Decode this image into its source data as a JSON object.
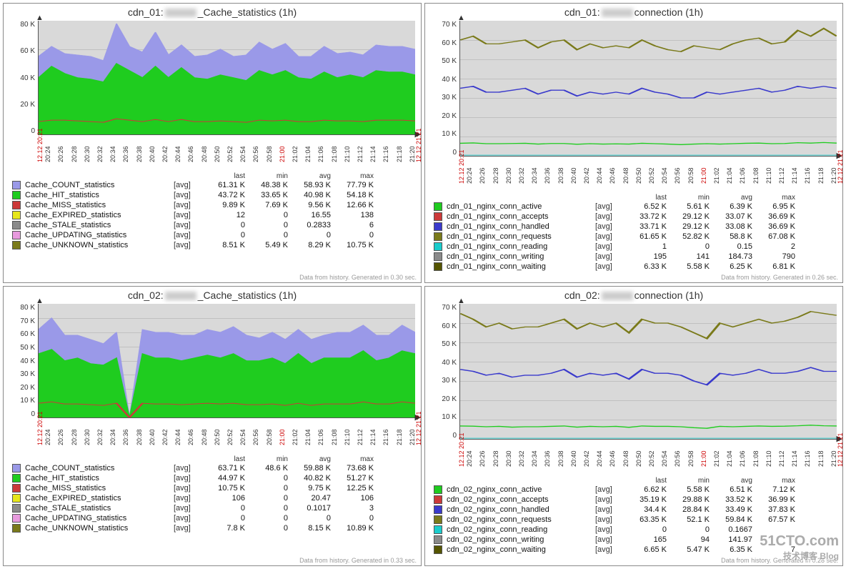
{
  "watermark": {
    "main": "51CTO.com",
    "sub": "技术博客   Blog"
  },
  "x_ticks": [
    "20:24",
    "20:26",
    "20:28",
    "20:30",
    "20:32",
    "20:34",
    "20:36",
    "20:38",
    "20:40",
    "20:42",
    "20:44",
    "20:46",
    "20:48",
    "20:50",
    "20:52",
    "20:54",
    "20:56",
    "20:58",
    "21:00",
    "21:02",
    "21:04",
    "21:06",
    "21:08",
    "21:10",
    "21:12",
    "21:14",
    "21:16",
    "21:18",
    "21:20"
  ],
  "x_start": "12.12 20:21",
  "x_end": "12.12 21:21",
  "panels": [
    {
      "id": "cache1",
      "title_pre": "cdn_01:",
      "title_post": "_Cache_statistics (1h)",
      "ymax": 80,
      "yticks": [
        "80 K",
        "60 K",
        "40 K",
        "20 K",
        "0"
      ],
      "footer": "Data from history. Generated in 0.30 sec.",
      "legend_head": [
        "last",
        "min",
        "avg",
        "max"
      ],
      "series": [
        {
          "name": "Cache_COUNT_statistics",
          "color": "#9a99e8",
          "agg": "[avg]",
          "last": "61.31 K",
          "min": "48.38 K",
          "avg": "58.93 K",
          "max": "77.79 K"
        },
        {
          "name": "Cache_HIT_statistics",
          "color": "#1fcc1f",
          "agg": "[avg]",
          "last": "43.72 K",
          "min": "33.65 K",
          "avg": "40.98 K",
          "max": "54.18 K"
        },
        {
          "name": "Cache_MISS_statistics",
          "color": "#cc3939",
          "agg": "[avg]",
          "last": "9.89 K",
          "min": "7.69 K",
          "avg": "9.56 K",
          "max": "12.66 K"
        },
        {
          "name": "Cache_EXPIRED_statistics",
          "color": "#e6e61a",
          "agg": "[avg]",
          "last": "12",
          "min": "0",
          "avg": "16.55",
          "max": "138"
        },
        {
          "name": "Cache_STALE_statistics",
          "color": "#8a8a8a",
          "agg": "[avg]",
          "last": "0",
          "min": "0",
          "avg": "0.2833",
          "max": "6"
        },
        {
          "name": "Cache_UPDATING_statistics",
          "color": "#e89ade",
          "agg": "[avg]",
          "last": "0",
          "min": "0",
          "avg": "0",
          "max": "0"
        },
        {
          "name": "Cache_UNKNOWN_statistics",
          "color": "#7a7a1a",
          "agg": "[avg]",
          "last": "8.51 K",
          "min": "5.49 K",
          "avg": "8.29 K",
          "max": "10.75 K"
        }
      ],
      "chart_data": {
        "type": "area",
        "x": [
          "20:24",
          "20:26",
          "20:28",
          "20:30",
          "20:32",
          "20:34",
          "20:36",
          "20:38",
          "20:40",
          "20:42",
          "20:44",
          "20:46",
          "20:48",
          "20:50",
          "20:52",
          "20:54",
          "20:56",
          "20:58",
          "21:00",
          "21:02",
          "21:04",
          "21:06",
          "21:08",
          "21:10",
          "21:12",
          "21:14",
          "21:16",
          "21:18",
          "21:20"
        ],
        "series": [
          {
            "name": "COUNT",
            "values": [
              55,
              62,
              57,
              56,
              55,
              52,
              78,
              62,
              58,
              72,
              56,
              63,
              55,
              56,
              60,
              55,
              56,
              65,
              60,
              64,
              55,
              55,
              62,
              57,
              58,
              56,
              63,
              62,
              62,
              60
            ]
          },
          {
            "name": "HIT",
            "values": [
              40,
              48,
              43,
              40,
              39,
              37,
              50,
              45,
              40,
              48,
              40,
              47,
              40,
              39,
              42,
              40,
              38,
              45,
              42,
              45,
              40,
              39,
              44,
              40,
              42,
              40,
              45,
              44,
              44,
              42
            ]
          },
          {
            "name": "MISS",
            "values": [
              9,
              10,
              10,
              9.5,
              9,
              8.5,
              11,
              10,
              9,
              10.5,
              9,
              10.5,
              9,
              9,
              9.5,
              9,
              8.5,
              10,
              9.5,
              10,
              9,
              9,
              10,
              9.5,
              9.5,
              9,
              10,
              10,
              10,
              9.5
            ]
          }
        ],
        "ylim": [
          0,
          80000
        ],
        "ylabel": "",
        "title": "cdn_01 Cache_statistics (1h)"
      }
    },
    {
      "id": "conn1",
      "title_pre": "cdn_01:",
      "title_post": "connection (1h)",
      "ymax": 70,
      "yticks": [
        "70 K",
        "60 K",
        "50 K",
        "40 K",
        "30 K",
        "20 K",
        "10 K",
        "0"
      ],
      "footer": "Data from history. Generated in 0.26 sec.",
      "legend_head": [
        "last",
        "min",
        "avg",
        "max"
      ],
      "series": [
        {
          "name": "cdn_01_nginx_conn_active",
          "color": "#1fcc1f",
          "agg": "[avg]",
          "last": "6.52 K",
          "min": "5.61 K",
          "avg": "6.39 K",
          "max": "6.95 K"
        },
        {
          "name": "cdn_01_nginx_conn_accepts",
          "color": "#cc3939",
          "agg": "[avg]",
          "last": "33.72 K",
          "min": "29.12 K",
          "avg": "33.07 K",
          "max": "36.69 K"
        },
        {
          "name": "cdn_01_nginx_conn_handled",
          "color": "#3a3acc",
          "agg": "[avg]",
          "last": "33.71 K",
          "min": "29.12 K",
          "avg": "33.08 K",
          "max": "36.69 K"
        },
        {
          "name": "cdn_01_nginx_conn_requests",
          "color": "#7a7a1a",
          "agg": "[avg]",
          "last": "61.65 K",
          "min": "52.82 K",
          "avg": "58.8 K",
          "max": "67.08 K"
        },
        {
          "name": "cdn_01_nginx_conn_reading",
          "color": "#1acccc",
          "agg": "[avg]",
          "last": "1",
          "min": "0",
          "avg": "0.15",
          "max": "2"
        },
        {
          "name": "cdn_01_nginx_conn_writing",
          "color": "#8a8a8a",
          "agg": "[avg]",
          "last": "195",
          "min": "141",
          "avg": "184.73",
          "max": "790"
        },
        {
          "name": "cdn_01_nginx_conn_waiting",
          "color": "#555500",
          "agg": "[avg]",
          "last": "6.33 K",
          "min": "5.58 K",
          "avg": "6.25 K",
          "max": "6.81 K"
        }
      ],
      "chart_data": {
        "type": "line",
        "x_same_as": "x_ticks",
        "series": [
          {
            "name": "requests",
            "values": [
              60,
              62,
              58,
              58,
              59,
              60,
              56,
              59,
              60,
              55,
              58,
              56,
              57,
              56,
              60,
              57,
              55,
              54,
              57,
              56,
              55,
              58,
              60,
              61,
              58,
              59,
              65,
              62,
              66,
              62
            ]
          },
          {
            "name": "handled",
            "values": [
              35,
              36,
              33,
              33,
              34,
              35,
              32,
              34,
              34,
              31,
              33,
              32,
              33,
              32,
              35,
              33,
              32,
              30,
              30,
              33,
              32,
              33,
              34,
              35,
              33,
              34,
              36,
              35,
              36,
              35
            ]
          },
          {
            "name": "active",
            "values": [
              6.5,
              6.7,
              6.3,
              6.3,
              6.4,
              6.5,
              6.1,
              6.4,
              6.4,
              6,
              6.3,
              6.1,
              6.2,
              6.1,
              6.5,
              6.3,
              6.1,
              5.8,
              6.1,
              6.3,
              6.1,
              6.3,
              6.5,
              6.6,
              6.3,
              6.4,
              6.8,
              6.6,
              6.9,
              6.6
            ]
          }
        ],
        "ylim": [
          0,
          70000
        ]
      }
    },
    {
      "id": "cache2",
      "title_pre": "cdn_02:",
      "title_post": "_Cache_statistics (1h)",
      "ymax": 80,
      "yticks": [
        "80 K",
        "70 K",
        "60 K",
        "50 K",
        "40 K",
        "30 K",
        "20 K",
        "10 K",
        "0"
      ],
      "footer": "Data from history. Generated in 0.33 sec.",
      "legend_head": [
        "last",
        "min",
        "avg",
        "max"
      ],
      "series": [
        {
          "name": "Cache_COUNT_statistics",
          "color": "#9a99e8",
          "agg": "[avg]",
          "last": "63.71 K",
          "min": "48.6 K",
          "avg": "59.88 K",
          "max": "73.68 K"
        },
        {
          "name": "Cache_HIT_statistics",
          "color": "#1fcc1f",
          "agg": "[avg]",
          "last": "44.97 K",
          "min": "0",
          "avg": "40.82 K",
          "max": "51.27 K"
        },
        {
          "name": "Cache_MISS_statistics",
          "color": "#cc3939",
          "agg": "[avg]",
          "last": "10.75 K",
          "min": "0",
          "avg": "9.75 K",
          "max": "12.25 K"
        },
        {
          "name": "Cache_EXPIRED_statistics",
          "color": "#e6e61a",
          "agg": "[avg]",
          "last": "106",
          "min": "0",
          "avg": "20.47",
          "max": "106"
        },
        {
          "name": "Cache_STALE_statistics",
          "color": "#8a8a8a",
          "agg": "[avg]",
          "last": "0",
          "min": "0",
          "avg": "0.1017",
          "max": "3"
        },
        {
          "name": "Cache_UPDATING_statistics",
          "color": "#e89ade",
          "agg": "[avg]",
          "last": "0",
          "min": "0",
          "avg": "0",
          "max": "0"
        },
        {
          "name": "Cache_UNKNOWN_statistics",
          "color": "#7a7a1a",
          "agg": "[avg]",
          "last": "7.8 K",
          "min": "0",
          "avg": "8.15 K",
          "max": "10.89 K"
        }
      ],
      "chart_data": {
        "type": "area",
        "x_same_as": "x_ticks",
        "series": [
          {
            "name": "COUNT",
            "values": [
              62,
              70,
              58,
              58,
              55,
              52,
              60,
              0,
              62,
              60,
              60,
              58,
              58,
              62,
              60,
              64,
              58,
              56,
              60,
              55,
              62,
              55,
              58,
              60,
              60,
              65,
              58,
              58,
              65,
              60
            ]
          },
          {
            "name": "HIT",
            "values": [
              45,
              48,
              40,
              42,
              38,
              37,
              42,
              0,
              45,
              42,
              42,
              40,
              42,
              44,
              42,
              45,
              40,
              40,
              42,
              38,
              45,
              38,
              42,
              42,
              42,
              47,
              40,
              42,
              47,
              45
            ]
          },
          {
            "name": "MISS",
            "values": [
              10,
              11,
              9.5,
              9.5,
              9,
              8.5,
              10,
              0,
              10,
              9.5,
              9.5,
              9,
              9.5,
              10,
              9.5,
              10,
              9,
              9,
              9.5,
              8.5,
              10,
              8.5,
              9.5,
              9.5,
              9.5,
              11,
              9.5,
              9.5,
              11,
              10
            ]
          }
        ],
        "ylim": [
          0,
          80000
        ]
      }
    },
    {
      "id": "conn2",
      "title_pre": "cdn_02:",
      "title_post": "connection (1h)",
      "ymax": 70,
      "yticks": [
        "70 K",
        "60 K",
        "50 K",
        "40 K",
        "30 K",
        "20 K",
        "10 K",
        "0"
      ],
      "footer": "Data from history. Generated in 0.28 sec.",
      "legend_head": [
        "last",
        "min",
        "avg",
        "max"
      ],
      "series": [
        {
          "name": "cdn_02_nginx_conn_active",
          "color": "#1fcc1f",
          "agg": "[avg]",
          "last": "6.62 K",
          "min": "5.58 K",
          "avg": "6.51 K",
          "max": "7.12 K"
        },
        {
          "name": "cdn_02_nginx_conn_accepts",
          "color": "#cc3939",
          "agg": "[avg]",
          "last": "35.19 K",
          "min": "29.88 K",
          "avg": "33.52 K",
          "max": "36.99 K"
        },
        {
          "name": "cdn_02_nginx_conn_handled",
          "color": "#3a3acc",
          "agg": "[avg]",
          "last": "34.4 K",
          "min": "28.84 K",
          "avg": "33.49 K",
          "max": "37.83 K"
        },
        {
          "name": "cdn_02_nginx_conn_requests",
          "color": "#7a7a1a",
          "agg": "[avg]",
          "last": "63.35 K",
          "min": "52.1 K",
          "avg": "59.84 K",
          "max": "67.57 K"
        },
        {
          "name": "cdn_02_nginx_conn_reading",
          "color": "#1acccc",
          "agg": "[avg]",
          "last": "0",
          "min": "0",
          "avg": "0.1667",
          "max": ""
        },
        {
          "name": "cdn_02_nginx_conn_writing",
          "color": "#8a8a8a",
          "agg": "[avg]",
          "last": "165",
          "min": "94",
          "avg": "141.97",
          "max": ""
        },
        {
          "name": "cdn_02_nginx_conn_waiting",
          "color": "#555500",
          "agg": "[avg]",
          "last": "6.65 K",
          "min": "5.47 K",
          "avg": "6.35 K",
          "max": "7"
        }
      ],
      "chart_data": {
        "type": "line",
        "x_same_as": "x_ticks",
        "series": [
          {
            "name": "requests",
            "values": [
              65,
              62,
              58,
              60,
              57,
              58,
              58,
              60,
              62,
              57,
              60,
              58,
              60,
              55,
              62,
              60,
              60,
              58,
              55,
              52,
              60,
              58,
              60,
              62,
              60,
              61,
              63,
              66,
              65,
              64
            ]
          },
          {
            "name": "handled",
            "values": [
              36,
              35,
              33,
              34,
              32,
              33,
              33,
              34,
              36,
              32,
              34,
              33,
              34,
              31,
              36,
              34,
              34,
              33,
              30,
              28,
              34,
              33,
              34,
              36,
              34,
              34,
              35,
              37,
              35,
              35
            ]
          },
          {
            "name": "active",
            "values": [
              6.7,
              6.6,
              6.3,
              6.5,
              6.1,
              6.3,
              6.3,
              6.5,
              6.7,
              6.1,
              6.5,
              6.3,
              6.5,
              6,
              6.7,
              6.5,
              6.5,
              6.3,
              5.8,
              5.5,
              6.5,
              6.3,
              6.5,
              6.7,
              6.5,
              6.6,
              6.8,
              7.1,
              6.8,
              6.7
            ]
          }
        ],
        "ylim": [
          0,
          70000
        ]
      }
    }
  ]
}
